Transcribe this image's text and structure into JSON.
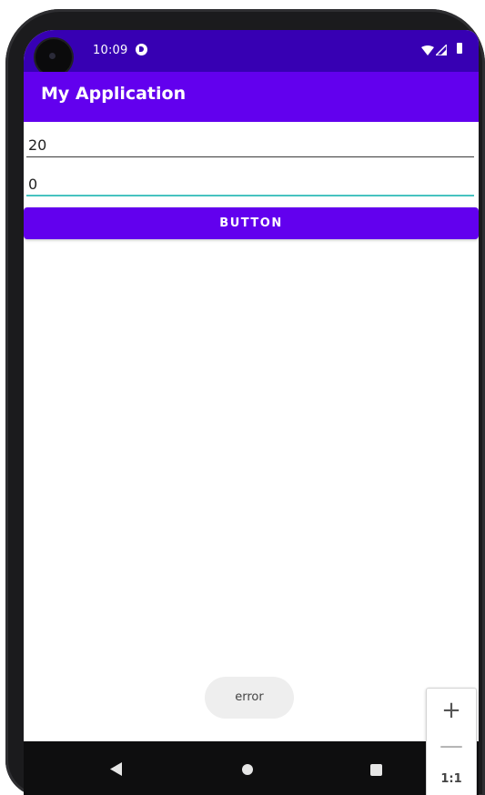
{
  "status_bar": {
    "time": "10:09",
    "icons": [
      "camera-cutout-icon",
      "notification-icon",
      "wifi-icon",
      "signal-icon",
      "battery-icon"
    ]
  },
  "app_bar": {
    "title": "My Application"
  },
  "inputs": [
    {
      "value": "20",
      "focused": false
    },
    {
      "value": "0",
      "focused": true
    }
  ],
  "button": {
    "label": "BUTTON"
  },
  "toast": {
    "text": "error"
  },
  "navigation": {
    "icons": [
      "back-icon",
      "home-icon",
      "recents-icon"
    ]
  },
  "zoom_controls": {
    "zoom_in": "+",
    "zoom_out": "—",
    "reset": "1:1"
  },
  "colors": {
    "status_bar": "#3700b3",
    "primary": "#6200ee",
    "accent_underline": "#47c3c0",
    "nav_bar": "#0e0e0f"
  }
}
